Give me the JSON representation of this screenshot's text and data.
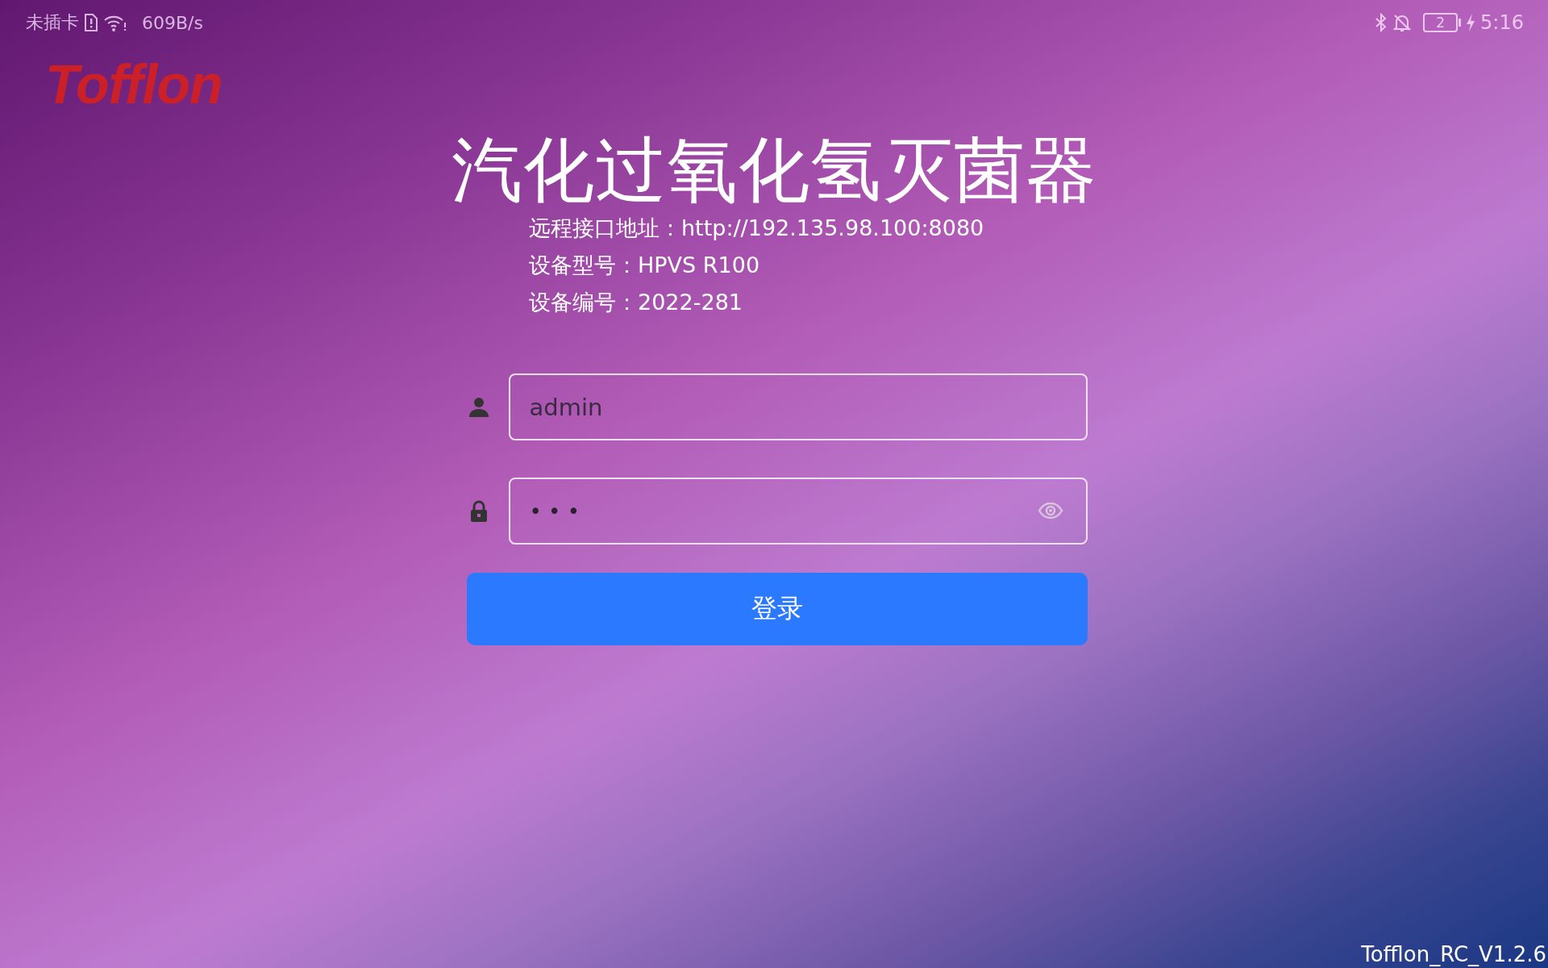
{
  "status_bar": {
    "carrier": "未插卡",
    "speed": "609B/s",
    "battery": "2",
    "time": "5:16"
  },
  "logo": "Tofflon",
  "title": "汽化过氧化氢灭菌器",
  "info_lines": [
    "远程接口地址：http://192.135.98.100:8080",
    "设备型号：HPVS R100",
    "设备编号：2022-281"
  ],
  "fields": [
    {
      "kind": "user",
      "value": "admin"
    },
    {
      "kind": "password",
      "value": "• • •"
    }
  ],
  "login_button": "登录",
  "version": "Tofflon_RC_V1.2.6"
}
